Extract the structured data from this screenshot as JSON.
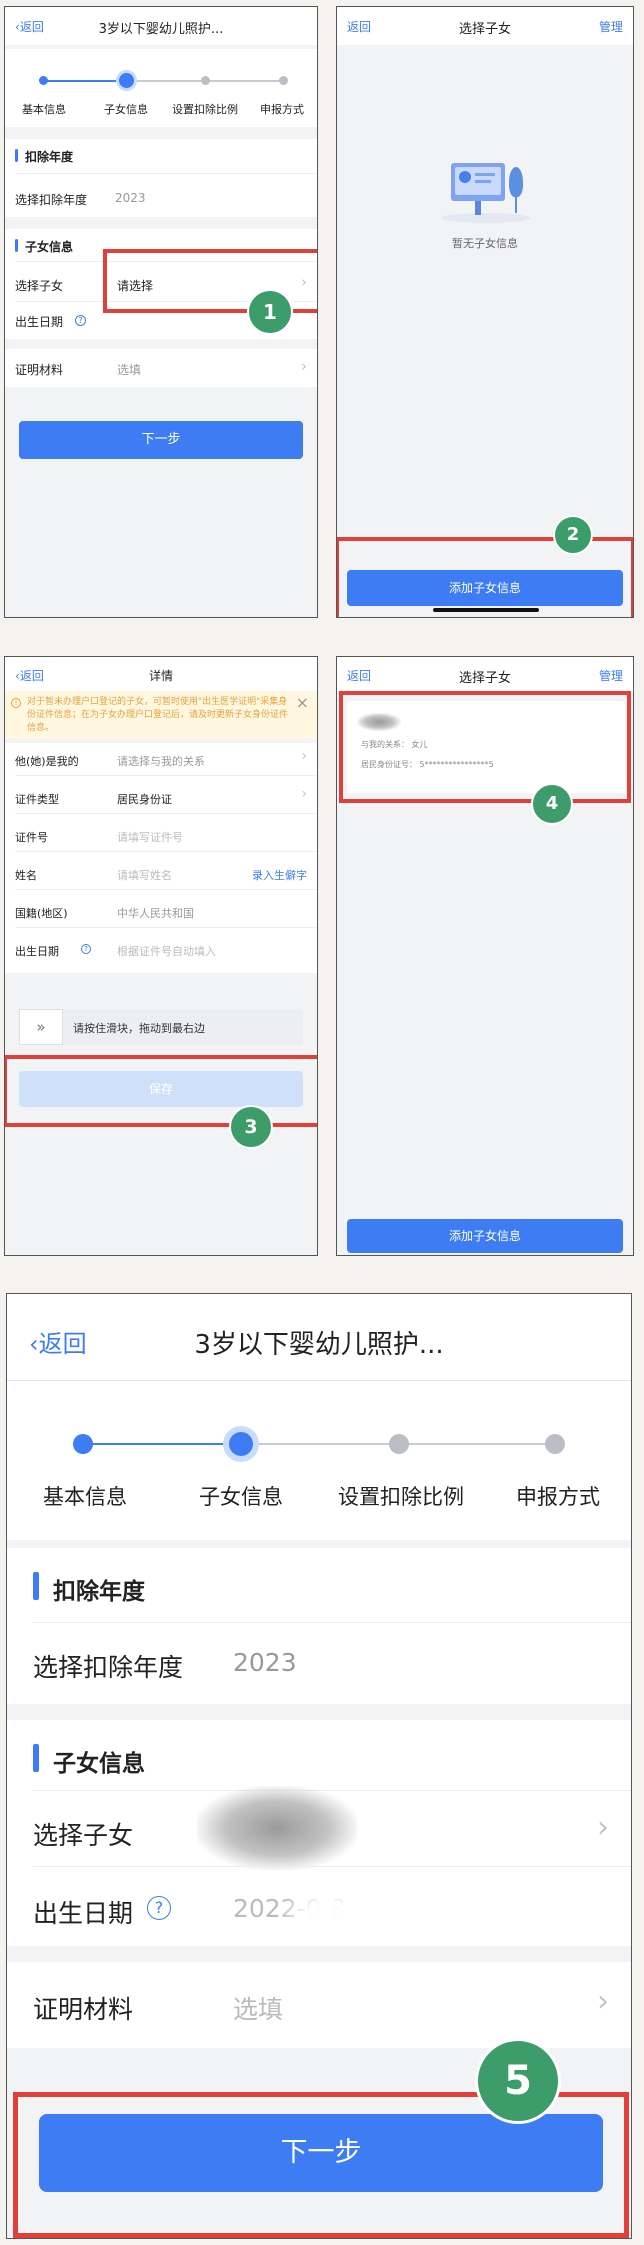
{
  "common": {
    "back_label": "返回",
    "manage_label": "管理",
    "chevron": "›",
    "question_mark": "?",
    "collapse_glyph": "«"
  },
  "colors": {
    "accent": "#3d7cf2",
    "annotation_red": "#e0403a",
    "badge_green": "#3c9c6a",
    "warning_bg": "#fff7e0",
    "warning_text": "#e6a23c"
  },
  "panel1": {
    "title": "3岁以下婴幼儿照护...",
    "steps": [
      {
        "label": "基本信息",
        "state": "done"
      },
      {
        "label": "子女信息",
        "state": "current"
      },
      {
        "label": "设置扣除比例",
        "state": "todo"
      },
      {
        "label": "申报方式",
        "state": "todo"
      }
    ],
    "deduction_section": "扣除年度",
    "deduction_year_label": "选择扣除年度",
    "deduction_year_value": "2023",
    "child_section": "子女信息",
    "select_child_label": "选择子女",
    "select_child_value": "请选择",
    "birth_label": "出生日期",
    "proof_label": "证明材料",
    "proof_value": "选填",
    "next_button": "下一步",
    "badge": "1"
  },
  "panel2": {
    "title": "选择子女",
    "empty_text": "暂无子女信息",
    "add_button": "添加子女信息",
    "badge": "2"
  },
  "panel3": {
    "title": "详情",
    "warning": "对于暂未办理户口登记的子女，可暂时使用\"出生医学证明\"采集身份证件信息；在为子女办理户口登记后，请及时更新子女身份证件信息。",
    "warning_close": "×",
    "relation_label": "他(她)是我的",
    "relation_placeholder": "请选择与我的关系",
    "id_type_label": "证件类型",
    "id_type_value": "居民身份证",
    "id_no_label": "证件号",
    "id_no_placeholder": "请填写证件号",
    "name_label": "姓名",
    "name_placeholder": "请填写姓名",
    "rare_char_link": "录入生僻字",
    "nationality_label": "国籍(地区)",
    "nationality_value": "中华人民共和国",
    "birth_label": "出生日期",
    "birth_placeholder": "根据证件号自动填入",
    "slider_text": "请按住滑块，拖动到最右边",
    "slider_handle": "»",
    "save_button": "保存",
    "badge": "3"
  },
  "panel4": {
    "title": "选择子女",
    "relation_text": "与我的关系：  女儿",
    "id_text": "居民身份证号：  5****************5",
    "add_button": "添加子女信息",
    "badge": "4"
  },
  "panel5": {
    "title": "3岁以下婴幼儿照护...",
    "steps": [
      {
        "label": "基本信息",
        "state": "done"
      },
      {
        "label": "子女信息",
        "state": "current"
      },
      {
        "label": "设置扣除比例",
        "state": "todo"
      },
      {
        "label": "申报方式",
        "state": "todo"
      }
    ],
    "deduction_section": "扣除年度",
    "deduction_year_label": "选择扣除年度",
    "deduction_year_value": "2023",
    "child_section": "子女信息",
    "select_child_label": "选择子女",
    "birth_label": "出生日期",
    "birth_value": "2022-0  8",
    "proof_label": "证明材料",
    "proof_value": "选填",
    "next_button": "下一步",
    "badge": "5"
  }
}
